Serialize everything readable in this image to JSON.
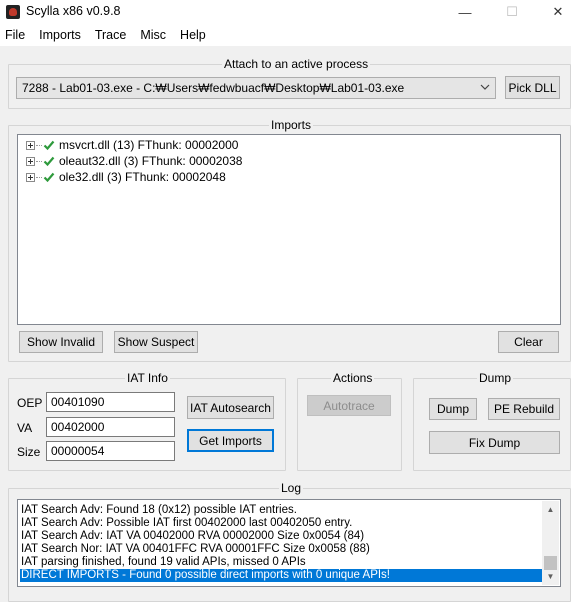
{
  "window": {
    "title": "Scylla x86 v0.9.8",
    "minimize": "—",
    "maximize": "☐",
    "close": "✕"
  },
  "menu": [
    "File",
    "Imports",
    "Trace",
    "Misc",
    "Help"
  ],
  "attach": {
    "group_title": "Attach to an active process",
    "process_value": "7288 - Lab01-03.exe - C:₩Users₩fedwbuacf₩Desktop₩Lab01-03.exe",
    "pick_dll_label": "Pick DLL"
  },
  "imports": {
    "group_title": "Imports",
    "items": [
      {
        "label": "msvcrt.dll (13) FThunk: 00002000"
      },
      {
        "label": "oleaut32.dll (3) FThunk: 00002038"
      },
      {
        "label": "ole32.dll (3) FThunk: 00002048"
      }
    ],
    "show_invalid_label": "Show Invalid",
    "show_suspect_label": "Show Suspect",
    "clear_label": "Clear"
  },
  "iat_info": {
    "group_title": "IAT Info",
    "oep_label": "OEP",
    "oep_value": "00401090",
    "va_label": "VA",
    "va_value": "00402000",
    "size_label": "Size",
    "size_value": "00000054",
    "autosearch_label": "IAT Autosearch",
    "get_imports_label": "Get Imports"
  },
  "actions": {
    "group_title": "Actions",
    "autotrace_label": "Autotrace"
  },
  "dump": {
    "group_title": "Dump",
    "dump_label": "Dump",
    "pe_rebuild_label": "PE Rebuild",
    "fix_dump_label": "Fix Dump"
  },
  "log": {
    "group_title": "Log",
    "lines": [
      "IAT Search Adv: Found 18 (0x12) possible IAT entries.",
      "IAT Search Adv: Possible IAT first 00402000 last 00402050 entry.",
      "IAT Search Adv: IAT VA 00402000 RVA 00002000 Size 0x0054 (84)",
      "IAT Search Nor: IAT VA 00401FFC RVA 00001FFC Size 0x0058 (88)",
      "IAT parsing finished, found 19 valid APIs, missed 0 APIs",
      "DIRECT IMPORTS - Found 0 possible direct imports with 0 unique APIs!"
    ],
    "selected_index": 5
  },
  "colors": {
    "accent": "#0078d7",
    "check_green": "#2e9a3c"
  }
}
